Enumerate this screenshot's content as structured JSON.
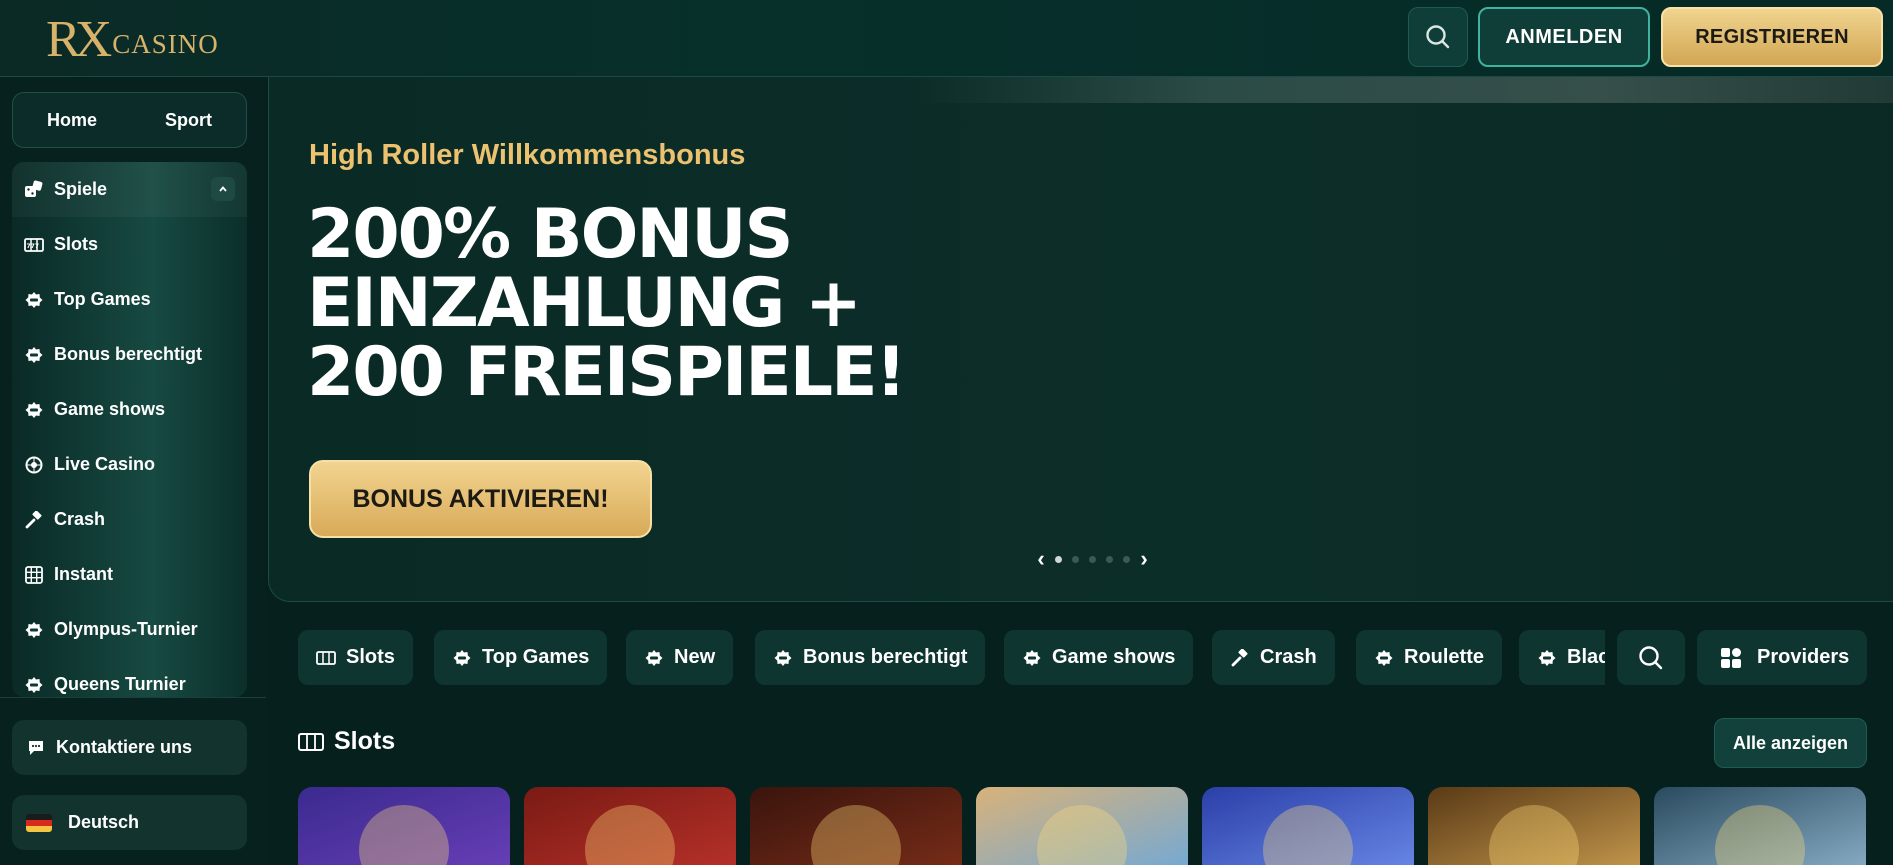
{
  "header": {
    "logo_rx": "RX",
    "logo_casino": "CASINO",
    "login_label": "ANMELDEN",
    "register_label": "REGISTRIEREN"
  },
  "sidebar": {
    "top_nav": [
      "Home",
      "Sport"
    ],
    "games_label": "Spiele",
    "items": [
      {
        "label": "Slots",
        "icon": "slots-icon"
      },
      {
        "label": "Top Games",
        "icon": "badge-icon"
      },
      {
        "label": "Bonus berechtigt",
        "icon": "badge-icon"
      },
      {
        "label": "Game shows",
        "icon": "badge-icon"
      },
      {
        "label": "Live Casino",
        "icon": "roulette-icon"
      },
      {
        "label": "Crash",
        "icon": "hammer-icon"
      },
      {
        "label": "Instant",
        "icon": "grid-icon"
      },
      {
        "label": "Olympus-Turnier",
        "icon": "badge-icon"
      },
      {
        "label": "Queens Turnier",
        "icon": "badge-icon"
      }
    ],
    "contact_label": "Kontaktiere uns",
    "language_label": "Deutsch"
  },
  "hero": {
    "subtitle": "High Roller Willkommensbonus",
    "title_lines": [
      "200% BONUS",
      "EINZAHLUNG +",
      "200 FREISPIELE!"
    ],
    "cta_label": "BONUS AKTIVIEREN!",
    "slide_count": 5,
    "active_slide": 1
  },
  "categories": {
    "chips": [
      {
        "label": "Slots",
        "icon": "slots-icon"
      },
      {
        "label": "Top Games",
        "icon": "badge-icon"
      },
      {
        "label": "New",
        "icon": "badge-icon"
      },
      {
        "label": "Bonus berechtigt",
        "icon": "badge-icon"
      },
      {
        "label": "Game shows",
        "icon": "badge-icon"
      },
      {
        "label": "Crash",
        "icon": "hammer-icon"
      },
      {
        "label": "Roulette",
        "icon": "badge-icon"
      },
      {
        "label": "Blac",
        "icon": "badge-icon"
      }
    ],
    "providers_label": "Providers"
  },
  "slots_section": {
    "title": "Slots",
    "show_all_label": "Alle anzeigen",
    "tiles": [
      {
        "name": "lion-pharaoh",
        "colors": [
          "#3a2a8e",
          "#6a3fb8"
        ]
      },
      {
        "name": "gold-coins",
        "colors": [
          "#7a1a14",
          "#b8322a"
        ]
      },
      {
        "name": "lady-portrait",
        "colors": [
          "#3a140d",
          "#7a2d18"
        ]
      },
      {
        "name": "sombrero",
        "colors": [
          "#d8b27a",
          "#6fa8d8"
        ]
      },
      {
        "name": "golden-frog",
        "colors": [
          "#2b3fa8",
          "#6a8ae8"
        ]
      },
      {
        "name": "egyptian-temple",
        "colors": [
          "#5a3a16",
          "#c79a4e"
        ]
      },
      {
        "name": "dark-knight",
        "colors": [
          "#2a4a5e",
          "#8ab0c8"
        ]
      }
    ]
  },
  "colors": {
    "accent_gold": "#ecc16f",
    "panel_dark": "#0f3530",
    "background": "#06201d"
  }
}
